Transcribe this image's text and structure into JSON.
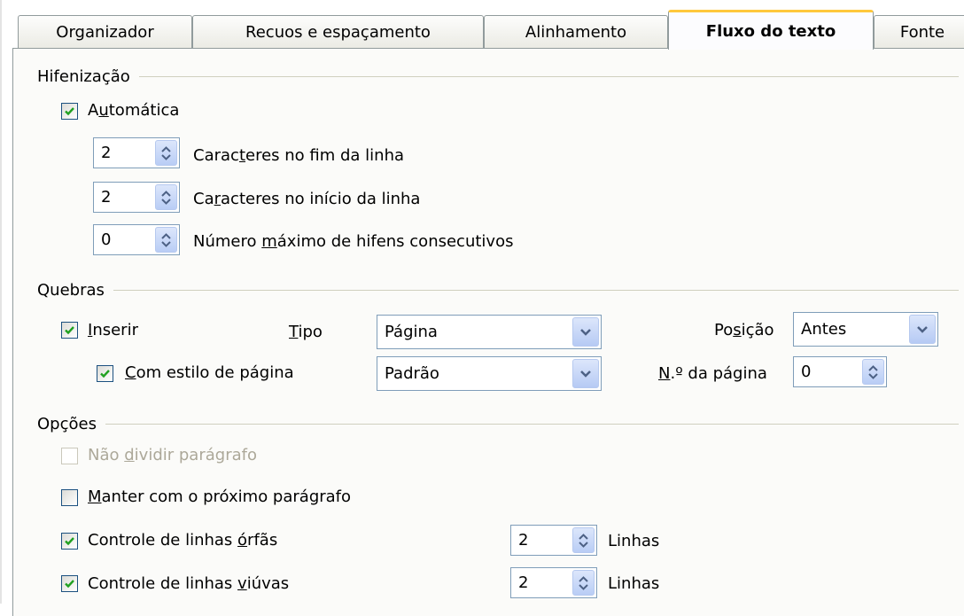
{
  "tabs": [
    {
      "label": "Organizador"
    },
    {
      "label": "Recuos e espaçamento"
    },
    {
      "label": "Alinhamento"
    },
    {
      "label": "Fluxo do texto"
    },
    {
      "label": "Fonte"
    }
  ],
  "hyphenation": {
    "title": "Hifenização",
    "automatic": {
      "pre": "A",
      "ul": "u",
      "post": "tomática",
      "checked": true
    },
    "chars_end": {
      "value": "2",
      "pre": "Carac",
      "ul": "t",
      "post": "eres no fim da linha"
    },
    "chars_start": {
      "value": "2",
      "pre": "Ca",
      "ul": "r",
      "post": "acteres no início da linha"
    },
    "max_hyphens": {
      "value": "0",
      "pre": "Número ",
      "ul": "m",
      "post": "áximo de hifens consecutivos"
    }
  },
  "breaks": {
    "title": "Quebras",
    "insert": {
      "pre": "",
      "ul": "I",
      "post": "nserir",
      "checked": true
    },
    "type_label": {
      "pre": "",
      "ul": "T",
      "post": "ipo"
    },
    "type_value": "Página",
    "position_label": {
      "pre": "Po",
      "ul": "s",
      "post": "ição"
    },
    "position_value": "Antes",
    "page_style": {
      "pre": "",
      "ul": "C",
      "post": "om estilo de página",
      "checked": true
    },
    "page_style_value": "Padrão",
    "page_num_label": {
      "pre": "",
      "ul": "N",
      "post": ".º da página"
    },
    "page_num_value": "0"
  },
  "options": {
    "title": "Opções",
    "dont_split": {
      "pre": "Não ",
      "ul": "d",
      "post": "ividir parágrafo",
      "checked": false,
      "disabled": true
    },
    "keep_next": {
      "pre": "",
      "ul": "M",
      "post": "anter com o próximo parágrafo",
      "checked": false
    },
    "orphan": {
      "pre": "Controle de linhas ",
      "ul": "ó",
      "post": "rfãs",
      "checked": true,
      "value": "2",
      "unit": "Linhas"
    },
    "widow": {
      "pre": "Controle de linhas ",
      "ul": "v",
      "post": "iúvas",
      "checked": true,
      "value": "2",
      "unit": "Linhas"
    }
  },
  "icons": {
    "check": "check-icon",
    "spin": "spin-arrows-icon",
    "dropdown": "chevron-down-icon"
  },
  "colors": {
    "tab_accent": "#ffc83c",
    "check": "#21a121",
    "border": "#7f9db9",
    "disabled_text": "#aca899"
  }
}
